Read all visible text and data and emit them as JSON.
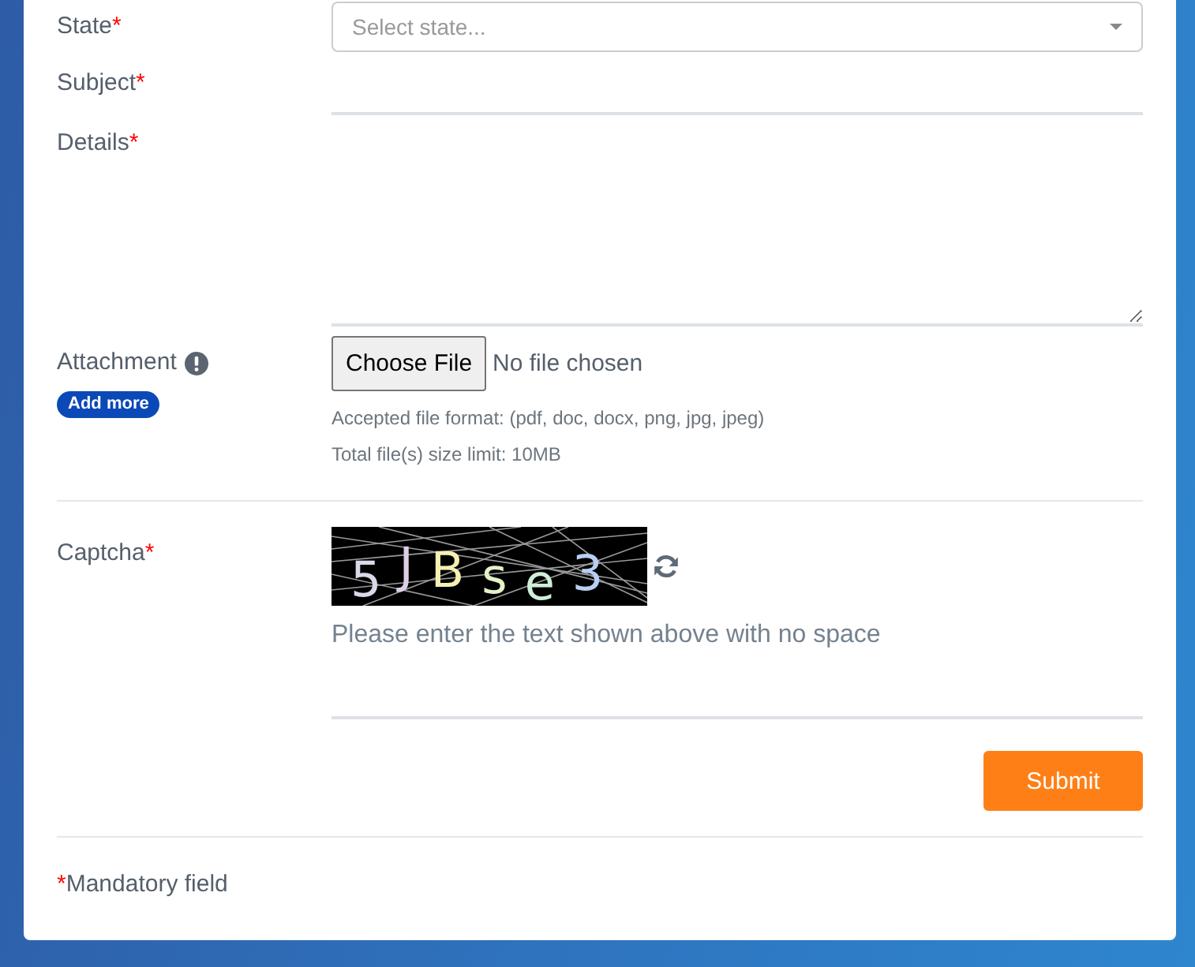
{
  "form": {
    "fields": [
      {
        "kind": "select",
        "label": "State",
        "required_mark": "*",
        "placeholder": "Select state..."
      },
      {
        "kind": "text",
        "label": "Subject",
        "required_mark": "*"
      },
      {
        "kind": "textarea",
        "label": "Details",
        "required_mark": "*"
      },
      {
        "kind": "file",
        "label": "Attachment",
        "add_more": "Add more",
        "button": "Choose File",
        "status": "No file chosen",
        "notes": [
          "Accepted file format: (pdf, doc, docx, png, jpg, jpeg)",
          "Total file(s) size limit: 10MB"
        ]
      },
      {
        "kind": "captcha",
        "label": "Captcha",
        "required_mark": "*",
        "captcha_text": "5JBse3",
        "hint": "Please enter the text shown above with no space"
      }
    ],
    "submit": "Submit",
    "footnote": {
      "mark": "*",
      "text": "Mandatory field"
    }
  }
}
